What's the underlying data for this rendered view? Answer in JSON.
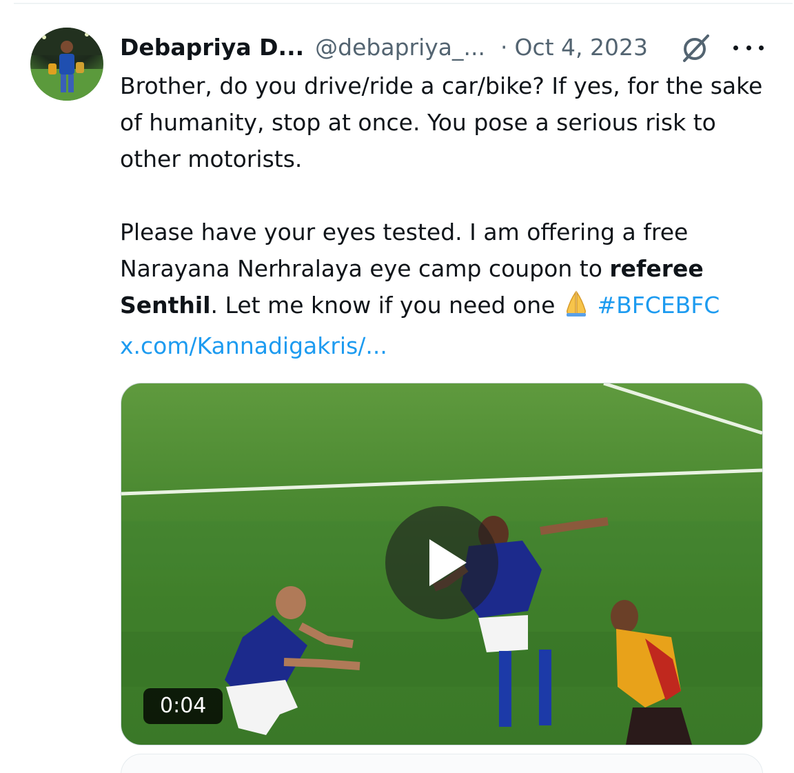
{
  "tweet": {
    "author_name": "Debapriya D...",
    "handle": "@debapriya_...",
    "separator": "·",
    "date": "Oct 4, 2023",
    "body": {
      "paragraph1": "Brother, do you drive/ride a car/bike? If yes, for the sake of humanity, stop at once. You pose a serious risk to other motorists.",
      "paragraph2_part1": "Please have your eyes tested. I am offering a free Narayana Nerhralaya eye camp coupon to ",
      "paragraph2_bold": "referee Senthil",
      "paragraph2_part2": ". Let me know if you need one ",
      "emoji": "🙏",
      "hashtag": "#BFCEBFC",
      "link": "x.com/Kannadigakris/..."
    }
  },
  "media": {
    "type": "video",
    "duration": "0:04"
  },
  "icons": {
    "grok": "grok-icon",
    "more": "more-icon",
    "play": "play-icon"
  },
  "colors": {
    "link": "#1d9bf0",
    "secondary_text": "#536471",
    "primary_text": "#0f1419"
  }
}
